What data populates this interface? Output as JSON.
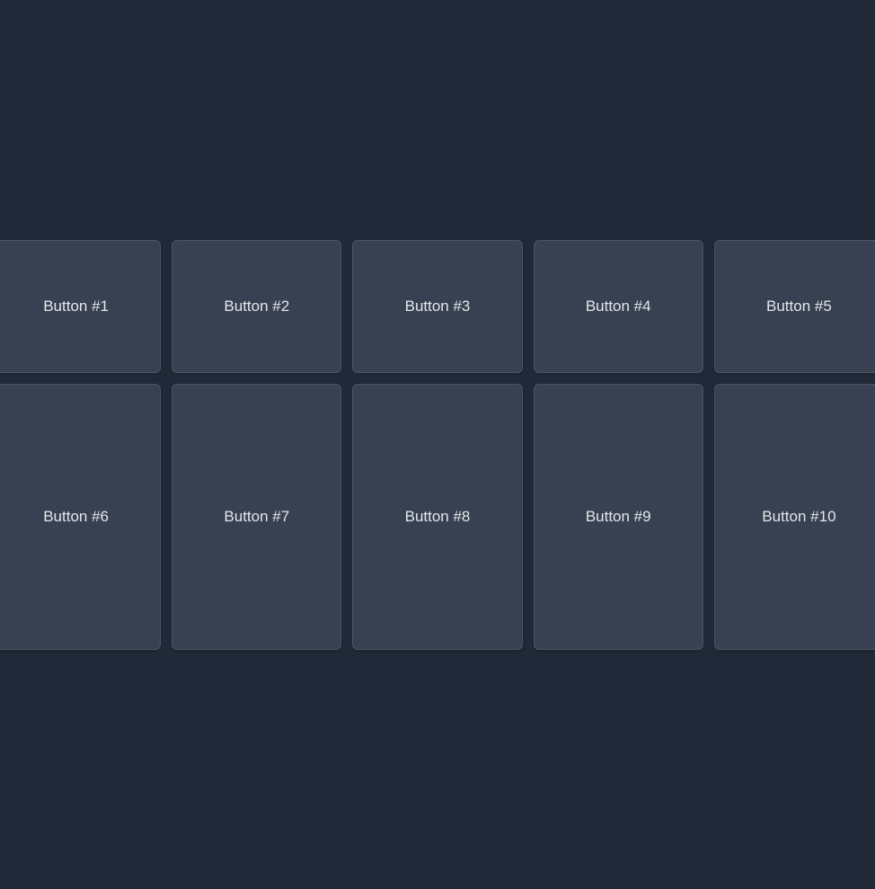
{
  "rows": [
    {
      "buttons": [
        {
          "label": "Button #1"
        },
        {
          "label": "Button #2"
        },
        {
          "label": "Button #3"
        },
        {
          "label": "Button #4"
        },
        {
          "label": "Button #5"
        }
      ]
    },
    {
      "buttons": [
        {
          "label": "Button #6"
        },
        {
          "label": "Button #7"
        },
        {
          "label": "Button #8"
        },
        {
          "label": "Button #9"
        },
        {
          "label": "Button #10"
        }
      ]
    }
  ]
}
